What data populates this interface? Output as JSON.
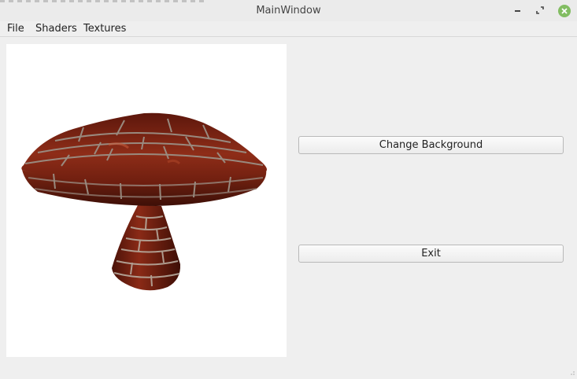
{
  "window": {
    "title": "MainWindow"
  },
  "menubar": {
    "items": [
      {
        "label": "File"
      },
      {
        "label": "Shaders"
      },
      {
        "label": "Textures"
      }
    ]
  },
  "viewport": {
    "object": "mushroom-model",
    "texture": "red-brick",
    "background_color": "#ffffff"
  },
  "controls": {
    "change_background_label": "Change Background",
    "exit_label": "Exit"
  },
  "icons": {
    "minimize": "minimize-icon",
    "maximize": "maximize-icon",
    "close": "close-icon",
    "resize": "resize-grip-icon"
  },
  "colors": {
    "close_button": "#82bd62",
    "brick": "#8b2a17",
    "mortar": "#9b8f84"
  }
}
